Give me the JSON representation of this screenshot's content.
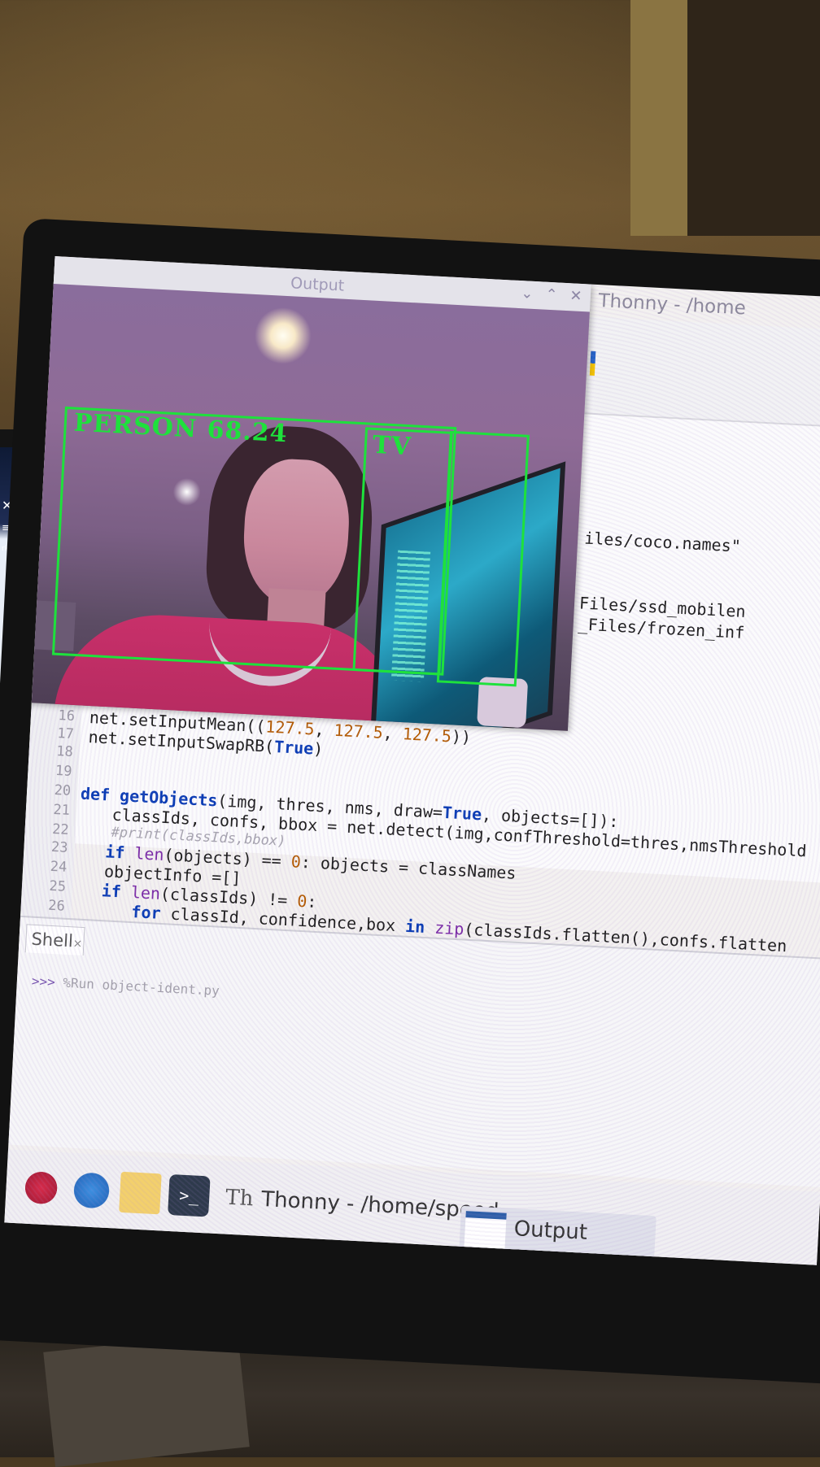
{
  "output_window": {
    "title": "Output",
    "controls": [
      "⌄",
      "⌃",
      "✕"
    ]
  },
  "detections": {
    "person_label": "PERSON",
    "person_score": "68.24",
    "tv_label": "TV"
  },
  "thonny": {
    "window_title": "Thonny - /home",
    "partial_lines": [
      "iles/coco.names\"",
      "Files/ssd_mobilen",
      "_Files/frozen_inf"
    ]
  },
  "editor": {
    "line_numbers": [
      "16",
      "17",
      "18",
      "19",
      "20",
      "21",
      "22",
      "23",
      "24",
      "25",
      "26"
    ]
  },
  "shell": {
    "tab_label": "Shell",
    "tab_close": "×",
    "prompt": ">>>",
    "command": "%Run object-ident.py"
  },
  "taskbar": {
    "terminal_glyph": ">_",
    "thonny_icon": "Th",
    "thonny_label": "Thonny - /home/speed...",
    "output_label": "Output"
  },
  "colors": {
    "detection_box": "#1ee13c",
    "keyword": "#0a3cb4",
    "number": "#b35a00"
  }
}
